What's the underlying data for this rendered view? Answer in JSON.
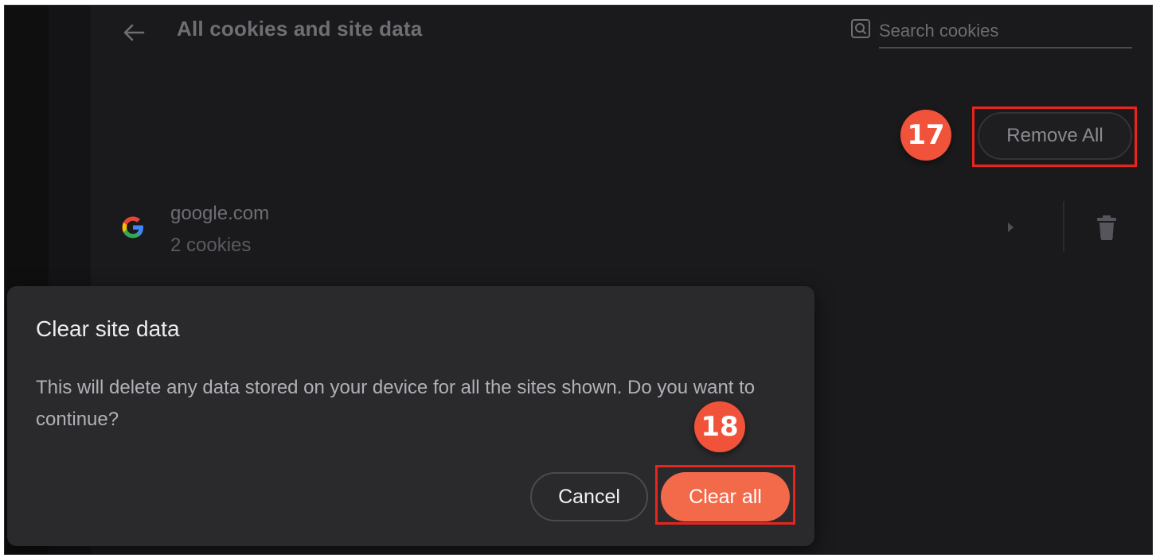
{
  "header": {
    "title": "All cookies and site data",
    "search_placeholder": "Search cookies"
  },
  "toolbar": {
    "remove_all_label": "Remove All"
  },
  "sites": [
    {
      "name": "google.com",
      "cookies": "2 cookies",
      "icon": "google-icon"
    }
  ],
  "dialog": {
    "title": "Clear site data",
    "body": "This will delete any data stored on your device for all the sites shown. Do you want to continue?",
    "cancel_label": "Cancel",
    "confirm_label": "Clear all"
  },
  "annotations": {
    "step_remove_all": "17",
    "step_clear_all": "18",
    "badge_color": "#f0523a",
    "highlight_color": "#e8251d"
  },
  "colors": {
    "accent": "#f26a4a",
    "background": "#1a1a1d",
    "dialog_background": "#2a2a2d"
  }
}
